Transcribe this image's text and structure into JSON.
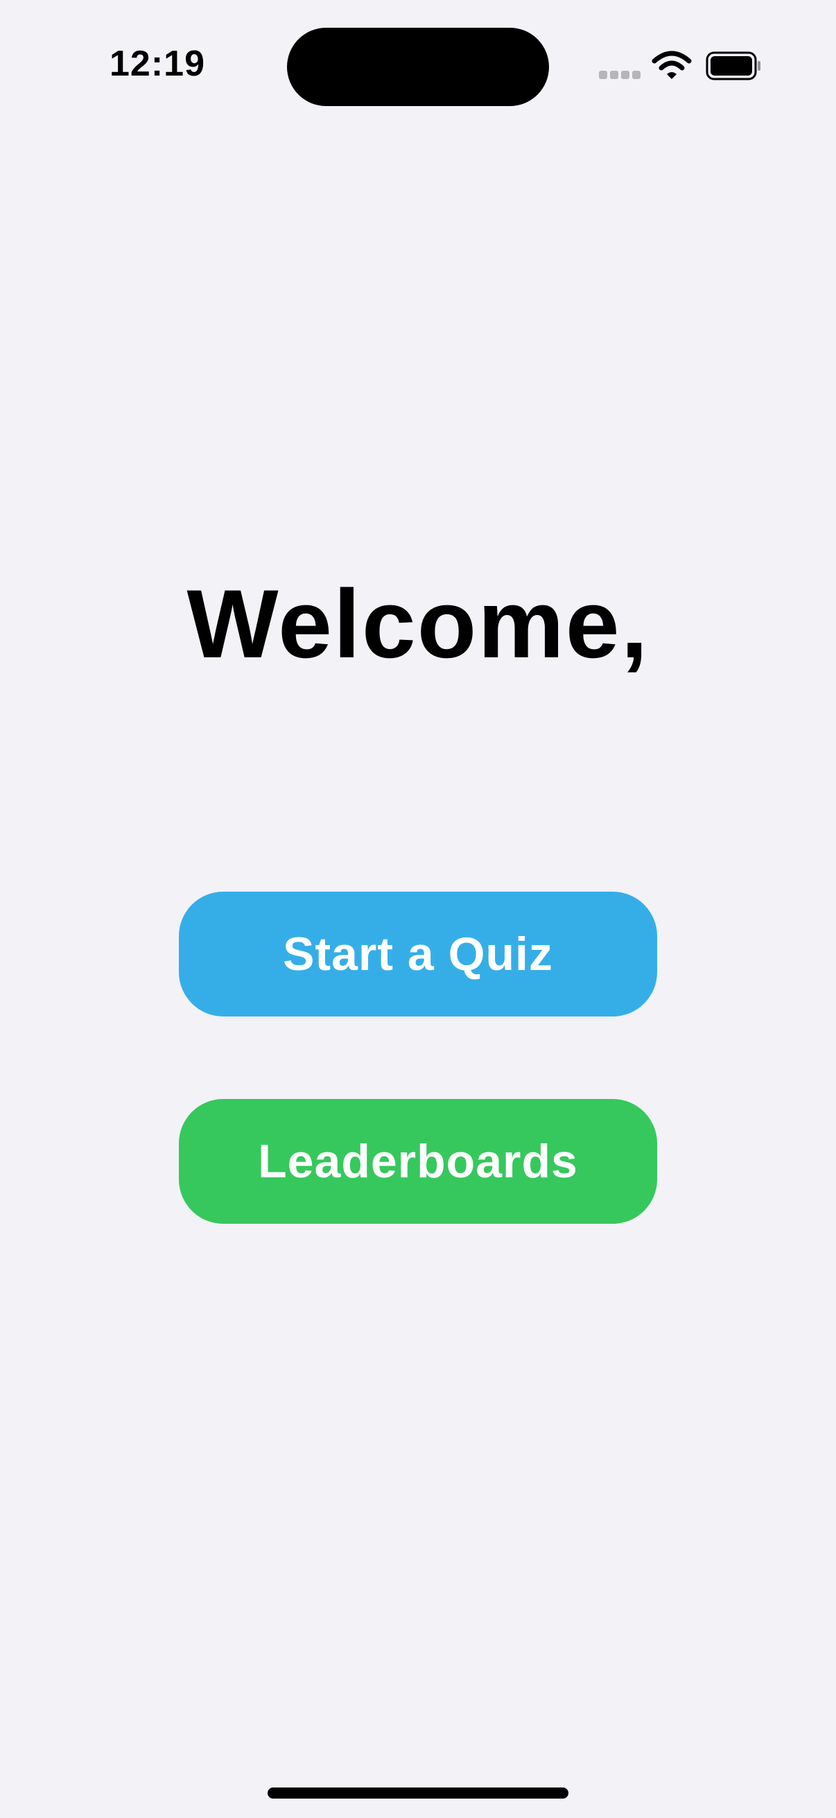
{
  "status_bar": {
    "time": "12:19",
    "icons": [
      "cellular-signal-icon",
      "wifi-icon",
      "battery-icon"
    ]
  },
  "main": {
    "title": "Welcome,",
    "buttons": {
      "start_quiz_label": "Start a Quiz",
      "leaderboards_label": "Leaderboards"
    }
  },
  "colors": {
    "background": "#f2f2f7",
    "start_quiz_button": "#35aee8",
    "leaderboards_button": "#36c85d",
    "button_text": "#ffffff"
  }
}
